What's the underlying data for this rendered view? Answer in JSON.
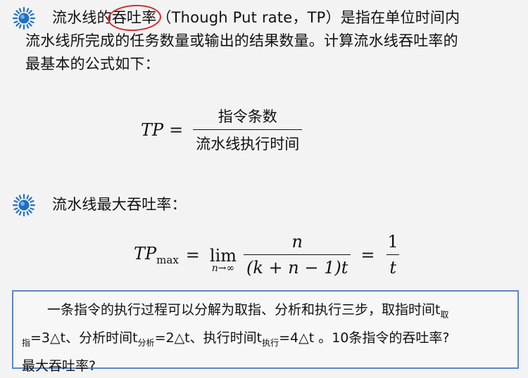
{
  "section1": {
    "pre": "流水线的",
    "circled": "吞吐率",
    "post": "（Though Put rate，TP）是指在单位时间内",
    "line2": "流水线所完成的任务数量或输出的结果数量。计算流水线吞吐率的",
    "line3": "最基本的公式如下："
  },
  "formula1": {
    "lhs": "TP",
    "eq": "=",
    "numerator": "指令条数",
    "denominator": "流水线执行时间"
  },
  "section2": {
    "title": "流水线最大吞吐率："
  },
  "formula2": {
    "lhs_main": "TP",
    "lhs_sub": "max",
    "eq": "=",
    "lim_word": "lim",
    "lim_under": "n→∞",
    "num": "n",
    "den": "(k + n − 1)t",
    "eq2": "=",
    "num2": "1",
    "den2": "t"
  },
  "question": {
    "p1": "一条指令的执行过程可以分解为取指、分析和执行三步，取指时间t",
    "p1_sub": "取",
    "p2_sub": "指",
    "p2": "=3△t、分析时间t",
    "p2_sub2": "分析",
    "p3": "=2△t、执行时间t",
    "p3_sub": "执行",
    "p4": "=4△t 。10条指令的吞吐率?",
    "p5": "最大吞吐率?"
  },
  "colors": {
    "accent": "#d42b2b",
    "box_border": "#5b86c8",
    "icon_blue": "#1f6fc4"
  }
}
